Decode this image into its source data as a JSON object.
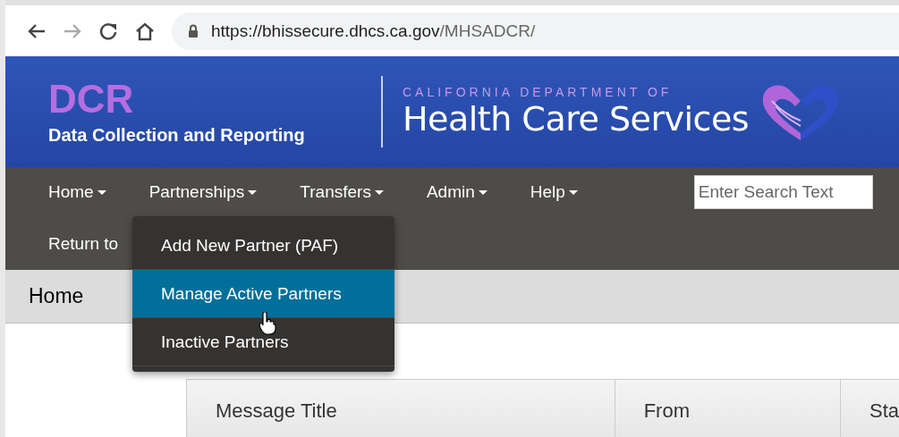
{
  "browser": {
    "url_host": "https://bhissecure.dhcs.ca.gov",
    "url_path": "/MHSADCR/"
  },
  "header": {
    "logo": "DCR",
    "subtitle": "Data Collection and Reporting",
    "dept_line": "CALIFORNIA DEPARTMENT OF",
    "dept_name": "Health Care Services"
  },
  "nav": {
    "items": [
      "Home",
      "Partnerships",
      "Transfers",
      "Admin",
      "Help"
    ],
    "search": {
      "placeholder": "Enter Search Text"
    },
    "second_row": "Return to"
  },
  "dropdown": [
    {
      "label": "Add New Partner (PAF)",
      "selected": false
    },
    {
      "label": "Manage Active Partners",
      "selected": true
    },
    {
      "label": "Inactive Partners",
      "selected": false
    }
  ],
  "breadcrumb": "Home",
  "table": {
    "columns": [
      "Message Title",
      "From",
      "Sta"
    ]
  }
}
